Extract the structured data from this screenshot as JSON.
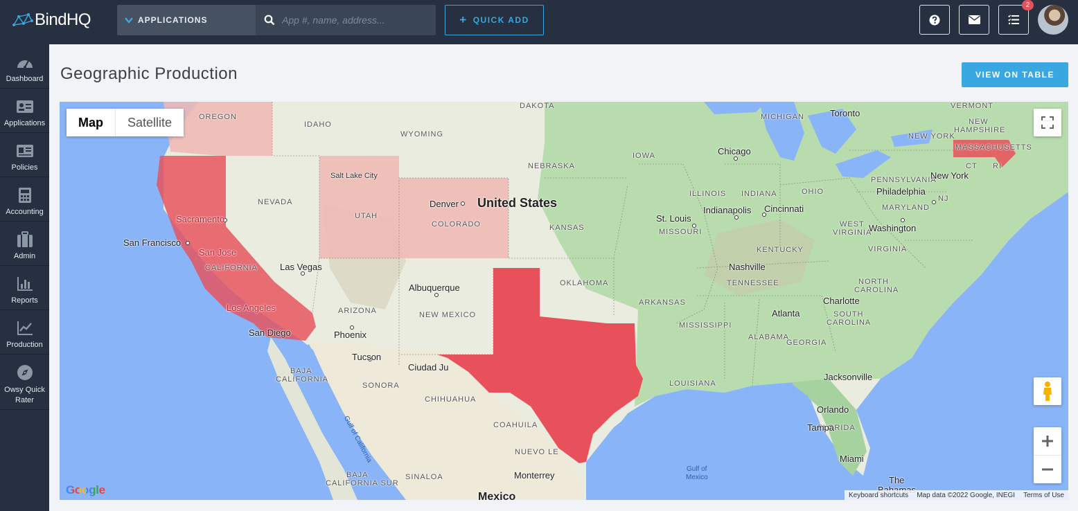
{
  "brand": {
    "name": "BindHQ"
  },
  "topbar": {
    "app_select_label": "APPLICATIONS",
    "search_placeholder": "App #, name, address...",
    "quick_add_label": "QUICK ADD",
    "tasks_badge": "2"
  },
  "sidebar": {
    "items": [
      {
        "label": "Dashboard",
        "icon": "dashboard-gauge-icon"
      },
      {
        "label": "Applications",
        "icon": "id-card-icon"
      },
      {
        "label": "Policies",
        "icon": "policy-card-icon"
      },
      {
        "label": "Accounting",
        "icon": "calculator-icon"
      },
      {
        "label": "Admin",
        "icon": "briefcase-icon"
      },
      {
        "label": "Reports",
        "icon": "bar-chart-icon"
      },
      {
        "label": "Production",
        "icon": "line-chart-icon"
      },
      {
        "label": "Owsy Quick Rater",
        "icon": "compass-icon"
      }
    ]
  },
  "page": {
    "title": "Geographic Production",
    "view_table_label": "VIEW ON TABLE"
  },
  "map": {
    "type_map": "Map",
    "type_satellite": "Satellite",
    "highlight_color_strong": "#e8505b",
    "highlight_color_light": "#f0b8b4",
    "labels": {
      "oregon": "OREGON",
      "idaho": "IDAHO",
      "wyoming": "WYOMING",
      "dakota": "DAKOTA",
      "nevada": "NEVADA",
      "utah": "UTAH",
      "colorado": "COLORADO",
      "california": "CALIFORNIA",
      "arizona": "ARIZONA",
      "new_mexico": "NEW MEXICO",
      "nebraska": "NEBRASKA",
      "kansas": "KANSAS",
      "oklahoma": "OKLAHOMA",
      "iowa": "IOWA",
      "illinois": "ILLINOIS",
      "indiana": "INDIANA",
      "ohio": "OHIO",
      "missouri": "MISSOURI",
      "arkansas": "ARKANSAS",
      "mississippi": "MISSISSIPPI",
      "alabama": "ALABAMA",
      "georgia": "GEORGIA",
      "tennessee": "TENNESSEE",
      "kentucky": "KENTUCKY",
      "louisiana": "LOUISIANA",
      "florida": "FLORIDA",
      "michigan": "MICHIGAN",
      "new_york": "NEW YORK",
      "pennsylvania": "PENNSYLVANIA",
      "maryland": "MARYLAND",
      "west": "WEST",
      "virginia_w": "VIRGINIA",
      "virginia": "VIRGINIA",
      "north": "NORTH",
      "carolina_n": "CAROLINA",
      "south": "SOUTH",
      "carolina_s": "CAROLINA",
      "vermont": "VERMONT",
      "new": "NEW",
      "hampshire": "HAMPSHIRE",
      "massachusetts": "MASSACHUSETTS",
      "ct": "CT",
      "ri": "RI",
      "nj": "NJ",
      "baja_california": "BAJA",
      "baja_california_2": "CALIFORNIA",
      "sonora": "SONORA",
      "chihuahua": "CHIHUAHUA",
      "coahuila": "COAHUILA",
      "nuevo_leon": "NUEVO LE",
      "sinaloa": "SINALOA",
      "baja_california_sur": "BAJA",
      "baja_california_sur_2": "CALIFORNIA SUR",
      "united_states": "United States",
      "sacramento": "Sacramento",
      "san_francisco": "San Francisco",
      "san_jose": "San Jose",
      "las_vegas": "Las Vegas",
      "los_angeles": "Los Angeles",
      "san_diego": "San Diego",
      "phoenix": "Phoenix",
      "tucson": "Tucson",
      "albuquerque": "Albuquerque",
      "ciudad_juarez": "Ciudad Ju",
      "salt_lake_city": "Salt Lake City",
      "denver": "Denver",
      "st_louis": "St. Louis",
      "chicago": "Chicago",
      "indianapolis": "Indianapolis",
      "cincinnati": "Cincinnati",
      "nashville": "Nashville",
      "atlanta": "Atlanta",
      "charlotte": "Charlotte",
      "washington": "Washington",
      "philadelphia": "Philadelphia",
      "new_york_city": "New York",
      "toronto": "Toronto",
      "jacksonville": "Jacksonville",
      "orlando": "Orlando",
      "tampa": "Tampa",
      "miami": "Miami",
      "monterrey": "Monterrey",
      "mexico": "Mexico",
      "the": "The",
      "bahamas": "Bahamas",
      "gulf_of_mexico": "Gulf of",
      "gulf_of_mexico_2": "Mexico",
      "gulf_of_california": "Gulf of California"
    },
    "attribution": {
      "shortcuts": "Keyboard shortcuts",
      "data": "Map data ©2022 Google, INEGI",
      "terms": "Terms of Use"
    },
    "logo": "Google"
  }
}
